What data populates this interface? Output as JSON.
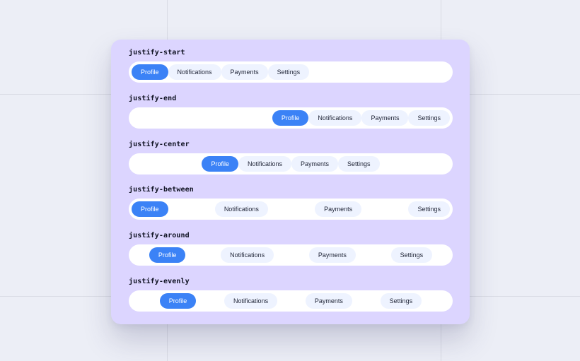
{
  "colors": {
    "background": "#eceef6",
    "card": "#dcd5ff",
    "bar": "#ffffff",
    "pill": "#eef3ff",
    "pill_active": "#3b82f6",
    "pill_active_text": "#ffffff",
    "label_text": "#0f1222"
  },
  "sections": [
    {
      "label": "justify-start",
      "items": [
        "Profile",
        "Notifications",
        "Payments",
        "Settings"
      ],
      "active": "Profile"
    },
    {
      "label": "justify-end",
      "items": [
        "Profile",
        "Notifications",
        "Payments",
        "Settings"
      ],
      "active": "Profile"
    },
    {
      "label": "justify-center",
      "items": [
        "Profile",
        "Notifications",
        "Payments",
        "Settings"
      ],
      "active": "Profile"
    },
    {
      "label": "justify-between",
      "items": [
        "Profile",
        "Notifications",
        "Payments",
        "Settings"
      ],
      "active": "Profile"
    },
    {
      "label": "justify-around",
      "items": [
        "Profile",
        "Notifications",
        "Payments",
        "Settings"
      ],
      "active": "Profile"
    },
    {
      "label": "justify-evenly",
      "items": [
        "Profile",
        "Notifications",
        "Payments",
        "Settings"
      ],
      "active": "Profile"
    }
  ]
}
